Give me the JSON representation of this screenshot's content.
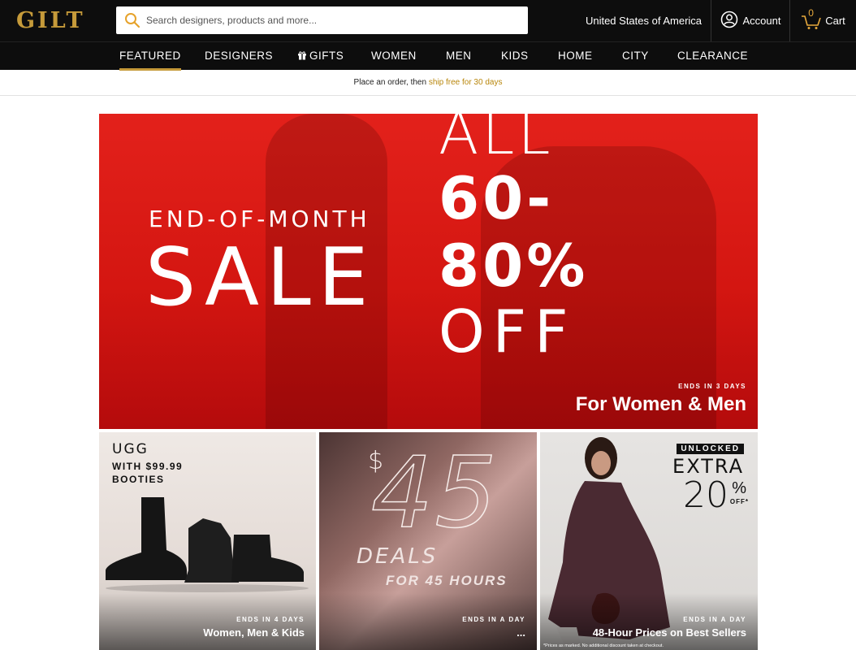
{
  "header": {
    "logo": "GILT",
    "search": {
      "placeholder": "Search designers, products and more..."
    },
    "country": "United States of America",
    "account_label": "Account",
    "cart_label": "Cart",
    "cart_count": "0"
  },
  "nav": {
    "items": [
      {
        "label": "FEATURED",
        "active": true
      },
      {
        "label": "DESIGNERS"
      },
      {
        "label": "GIFTS",
        "icon": "gift-icon"
      },
      {
        "label": "WOMEN"
      },
      {
        "label": "MEN"
      },
      {
        "label": "KIDS"
      },
      {
        "label": "HOME"
      },
      {
        "label": "CITY"
      },
      {
        "label": "CLEARANCE"
      }
    ]
  },
  "promo": {
    "text": "Place an order, then ",
    "link": "ship free for 30 days"
  },
  "hero": {
    "eyebrow": "END-OF-MONTH",
    "headline": "SALE",
    "offer_line1": "ALL",
    "offer_line2": "60-",
    "offer_line3": "80%",
    "offer_line4": "OFF",
    "ends": "ENDS IN 3 DAYS",
    "subtitle": "For Women & Men"
  },
  "tiles": [
    {
      "brand": "UGG",
      "line1": "WITH $99.99",
      "line2": "BOOTIES",
      "ends": "ENDS IN 4 DAYS",
      "label": "Women, Men & Kids"
    },
    {
      "dollar": "$",
      "number": "45",
      "word": "DEALS",
      "hours": "FOR 45 HOURS",
      "ends": "ENDS IN A DAY",
      "label": "..."
    },
    {
      "badge": "UNLOCKED",
      "extra": "EXTRA",
      "percent": "20",
      "percent_sign": "%",
      "off": "OFF*",
      "fine_print": "*Prices as marked. No additional discount taken at checkout.",
      "ends": "ENDS IN A DAY",
      "label": "48-Hour Prices on Best Sellers"
    }
  ],
  "colors": {
    "brand_gold": "#c59a3a",
    "topbar": "#0d0d0d",
    "hero_red": "#d41611"
  }
}
